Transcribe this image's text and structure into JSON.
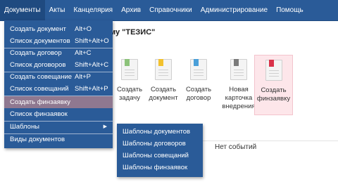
{
  "menubar": {
    "items": [
      {
        "label": "Документы"
      },
      {
        "label": "Акты"
      },
      {
        "label": "Канцелярия"
      },
      {
        "label": "Архив"
      },
      {
        "label": "Справочники"
      },
      {
        "label": "Администрирование"
      },
      {
        "label": "Помощь"
      }
    ]
  },
  "page": {
    "title": "ему \"ТЕЗИС\""
  },
  "tiles": [
    {
      "label": "Создать задачу",
      "icon": "task-doc-icon",
      "flag_color": "#8cc27a"
    },
    {
      "label": "Создать документ",
      "icon": "document-icon",
      "flag_color": "#f2c12e"
    },
    {
      "label": "Создать договор",
      "icon": "contract-icon",
      "flag_color": "#4a9fd8"
    },
    {
      "label": "Новая карточка внедрения",
      "icon": "implementation-card-icon",
      "flag_color": "#7a7a7a"
    },
    {
      "label": "Создать финзаявку",
      "icon": "finrequest-icon",
      "flag_color": "#d9334a"
    }
  ],
  "events": {
    "empty_text": "Нет событий"
  },
  "dropdown": {
    "items": [
      {
        "label": "Создать документ",
        "shortcut": "Alt+O"
      },
      {
        "label": "Список документов",
        "shortcut": "Shift+Alt+O"
      },
      {
        "label": "Создать договор",
        "shortcut": "Alt+C"
      },
      {
        "label": "Список договоров",
        "shortcut": "Shift+Alt+C"
      },
      {
        "label": "Создать совещание",
        "shortcut": "Alt+P"
      },
      {
        "label": "Список совещаний",
        "shortcut": "Shift+Alt+P"
      },
      {
        "label": "Создать финзаявку",
        "shortcut": ""
      },
      {
        "label": "Список финзаявок",
        "shortcut": ""
      },
      {
        "label": "Шаблоны",
        "shortcut": ""
      },
      {
        "label": "Виды документов",
        "shortcut": ""
      }
    ],
    "selected_index": 6
  },
  "submenu": {
    "items": [
      {
        "label": "Шаблоны документов"
      },
      {
        "label": "Шаблоны договоров"
      },
      {
        "label": "Шаблоны совещаний"
      },
      {
        "label": "Шаблоны финзаявок"
      }
    ]
  },
  "colors": {
    "menubar_bg": "#2a5b98",
    "selected_item_bg": "#8f7890",
    "highlight_tile_bg": "#fde6ea"
  }
}
